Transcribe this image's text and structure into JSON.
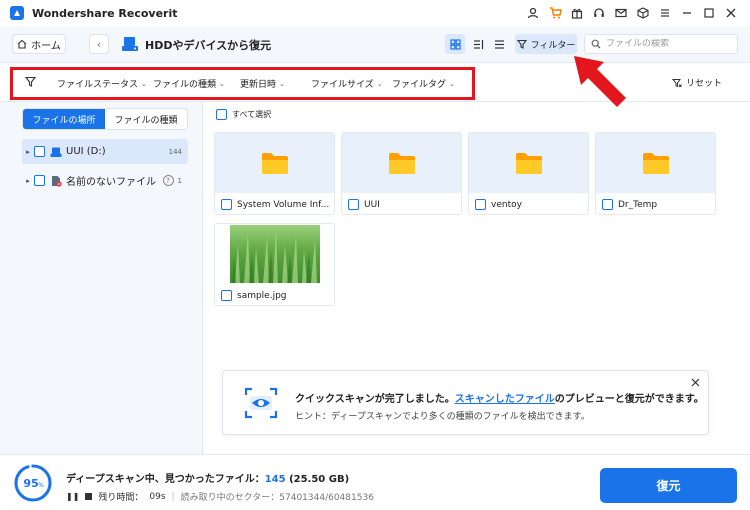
{
  "app": {
    "title": "Wondershare Recoverit"
  },
  "titlebar_icons": [
    "user-icon",
    "cart-icon",
    "gift-icon",
    "headset-icon",
    "mail-icon",
    "box-icon",
    "menu-icon",
    "minimize-icon",
    "maximize-icon",
    "close-icon"
  ],
  "nav": {
    "home_label": "ホーム",
    "page_title": "HDDやデバイスから復元",
    "filter_label": "フィルター",
    "search_placeholder": "ファイルの検索"
  },
  "filters": {
    "items": [
      {
        "label": "ファイルステータス"
      },
      {
        "label": "ファイルの種類"
      },
      {
        "label": "更新日時"
      },
      {
        "label": "ファイルサイズ"
      },
      {
        "label": "ファイルタグ"
      }
    ],
    "reset_label": "リセット"
  },
  "sidebar": {
    "tabs": [
      {
        "label": "ファイルの場所"
      },
      {
        "label": "ファイルの種類"
      }
    ],
    "tree": [
      {
        "label": "UUI (D:)",
        "count": "144"
      },
      {
        "label": "名前のないファイル",
        "count": "1"
      }
    ]
  },
  "main": {
    "select_all_label": "すべて選択",
    "files": [
      {
        "name": "System Volume Inf...",
        "type": "folder"
      },
      {
        "name": "UUI",
        "type": "folder"
      },
      {
        "name": "ventoy",
        "type": "folder"
      },
      {
        "name": "Dr_Temp",
        "type": "folder"
      },
      {
        "name": "sample.jpg",
        "type": "image"
      }
    ]
  },
  "toast": {
    "msg_before": "クイックスキャンが完了しました。",
    "msg_link": "スキャンしたファイル",
    "msg_after": "のプレビューと復元ができます。",
    "hint": "ヒント：ディープスキャンでより多くの種類のファイルを検出できます。"
  },
  "status": {
    "progress_percent": 95,
    "progress_number": "95",
    "progress_unit": "%",
    "title_prefix": "ディープスキャン中、見つかったファイル：",
    "found_count": "145",
    "found_size": "(25.50 GB)",
    "remaining_label": "残り時間：",
    "remaining_value": "09s",
    "sector_text": "読み取り中のセクター：57401344/60481536",
    "recover_label": "復元"
  },
  "colors": {
    "accent": "#1a73e8",
    "highlight": "#e2161c",
    "folder": "#ffb300"
  }
}
